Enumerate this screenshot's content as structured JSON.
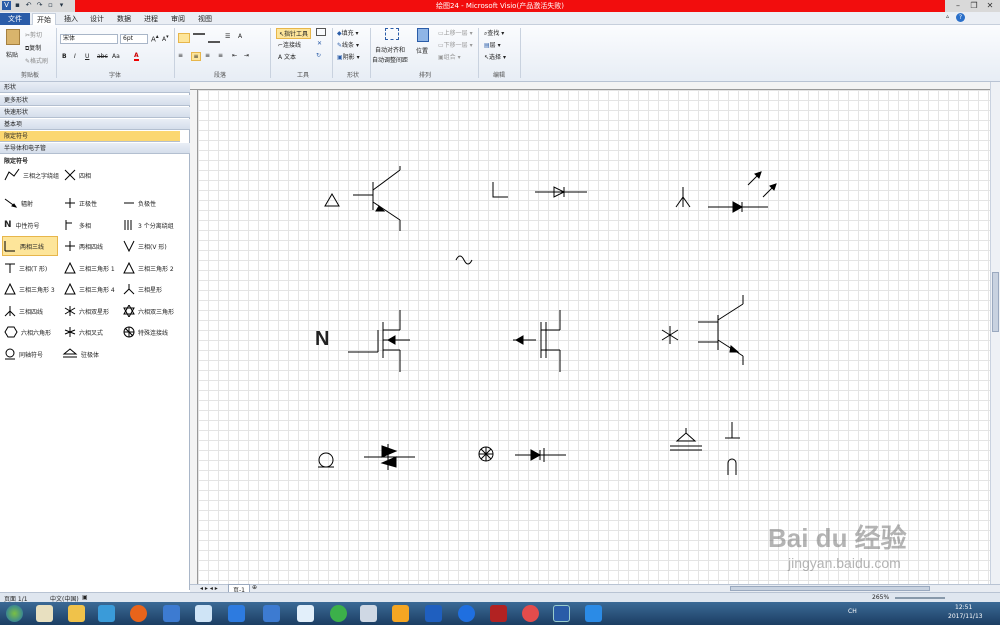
{
  "window": {
    "title": "绘图24 - Microsoft Visio(产品激活失败)",
    "quick_access": [
      "V",
      "save",
      "undo",
      "redo",
      "▾"
    ]
  },
  "tabs": [
    "文件",
    "开始",
    "插入",
    "设计",
    "数据",
    "进程",
    "审阅",
    "视图"
  ],
  "ribbon": {
    "clipboard": {
      "paste": "粘贴",
      "cut": "剪切",
      "copy": "复制",
      "format_painter": "格式刷",
      "label": "剪贴板"
    },
    "font": {
      "family": "宋体",
      "size": "6pt",
      "bold": "B",
      "italic": "I",
      "underline": "U",
      "strike": "abc",
      "case": "Aa",
      "color": "A",
      "label": "字体"
    },
    "paragraph": {
      "label": "段落"
    },
    "tools": {
      "pointer": "指针工具",
      "connector": "连接线",
      "text": "文本",
      "label": "工具"
    },
    "shape": {
      "fill": "填充",
      "line": "线条",
      "shadow": "阴影",
      "label": "形状"
    },
    "arrange": {
      "auto_align": "自动对齐和",
      "auto_adjust": "自动调整间距",
      "position": "位置",
      "bring_forward": "上移一层",
      "send_backward": "下移一层",
      "group": "组合",
      "label": "排列"
    },
    "editing": {
      "find": "查找",
      "layers": "层",
      "select": "选择",
      "label": "编辑"
    }
  },
  "shapes_panel": {
    "header": "形状",
    "nav": [
      "更多形状",
      "快速形状",
      "基本项",
      "限定符号",
      "半导体和电子管"
    ],
    "selected_nav": "限定符号",
    "stencil_title": "限定符号",
    "items": [
      "三相之字绕组",
      "四相",
      "辐射",
      "正极性",
      "负极性",
      "中性符号",
      "多相",
      "3 个分离绕组",
      "两相三线",
      "两相四线",
      "三相(V 形)",
      "三相(T 形)",
      "三相三角形 1",
      "三相三角形 2",
      "三相三角形 3",
      "三相三角形 4",
      "三相星形",
      "三相四线",
      "六相双星形",
      "六相双三角形",
      "六相六角形",
      "六相叉式",
      "特殊连接线",
      "同轴符号",
      "驻极体"
    ],
    "selected_item": "两相三线"
  },
  "canvas": {
    "neutral_label": "N",
    "page_tab": "页-1"
  },
  "statusbar": {
    "page": "页面 1/1",
    "language": "中文(中国)",
    "zoom": "265%"
  },
  "taskbar": {
    "time": "12:51",
    "date": "2017/11/13",
    "lang": "CH"
  },
  "watermark": {
    "brand": "Bai du 经验",
    "url": "jingyan.baidu.com"
  }
}
